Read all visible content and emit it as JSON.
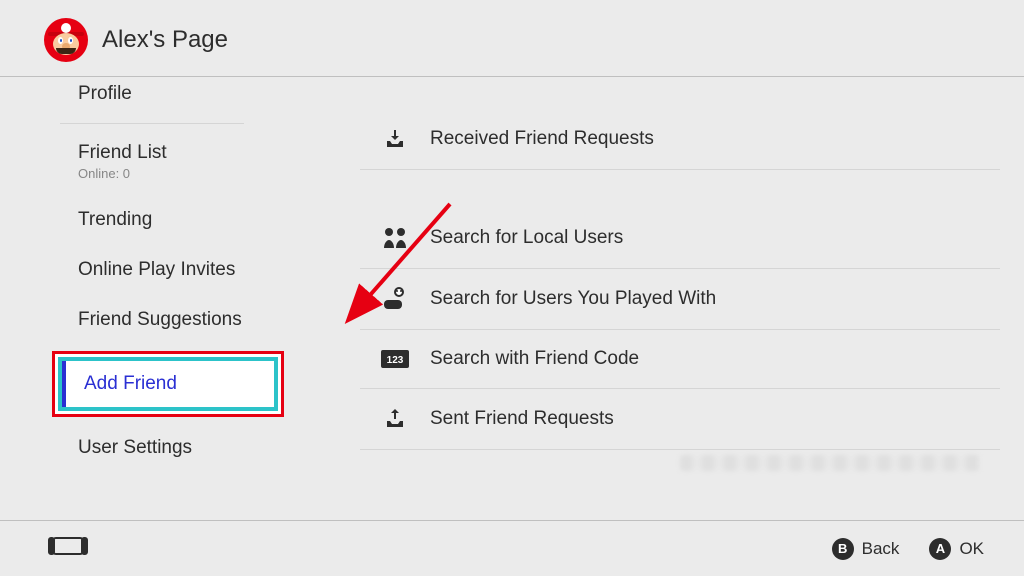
{
  "header": {
    "title": "Alex's Page"
  },
  "sidebar": {
    "profile": "Profile",
    "friendList": {
      "label": "Friend List",
      "sub": "Online: 0"
    },
    "trending": "Trending",
    "onlinePlay": "Online Play Invites",
    "friendSuggestions": "Friend Suggestions",
    "addFriend": "Add Friend",
    "userSettings": "User Settings"
  },
  "main": {
    "received": "Received Friend Requests",
    "local": "Search for Local Users",
    "played": "Search for Users You Played With",
    "code": "Search with Friend Code",
    "sent": "Sent Friend Requests"
  },
  "footer": {
    "back": "Back",
    "ok": "OK"
  },
  "colors": {
    "accentRed": "#e60012",
    "highlightTeal": "#2cc3c9",
    "selectBlue": "#2a2fd3"
  }
}
